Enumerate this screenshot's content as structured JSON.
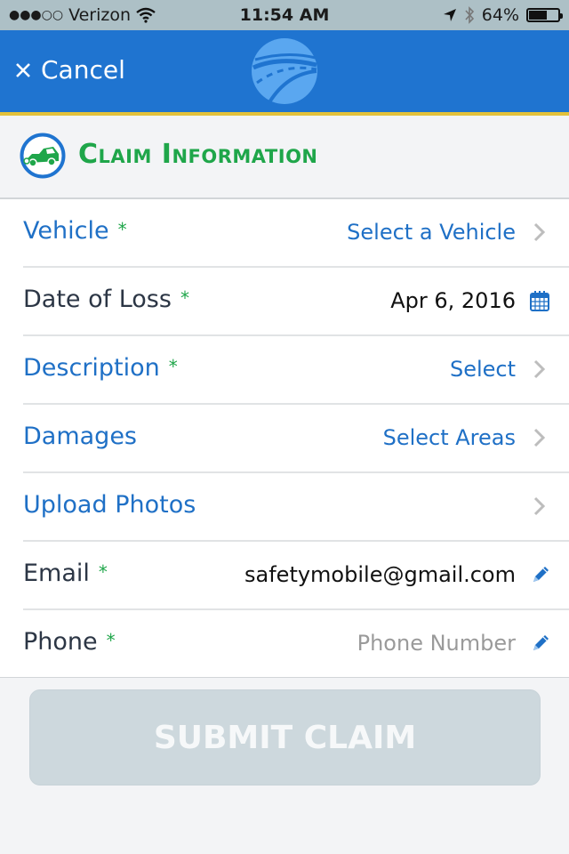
{
  "status_bar": {
    "signal_dots": "●●●○○",
    "carrier": "Verizon",
    "time": "11:54 AM",
    "battery_percent_label": "64%",
    "battery_level": 0.64
  },
  "nav": {
    "cancel_label": "Cancel",
    "logo": "road-logo-icon"
  },
  "section": {
    "title": "Claim Information",
    "icon": "tow-truck-icon"
  },
  "rows": [
    {
      "label": "Vehicle",
      "required": "*",
      "value": "Select a Vehicle",
      "trail_icon": "chevron-right-icon"
    },
    {
      "label": "Date of Loss",
      "required": "*",
      "value": "Apr 6, 2016",
      "trail_icon": "calendar-icon"
    },
    {
      "label": "Description",
      "required": "*",
      "value": "Select",
      "trail_icon": "chevron-right-icon"
    },
    {
      "label": "Damages",
      "required": "",
      "value": "Select Areas",
      "trail_icon": "chevron-right-icon"
    },
    {
      "label": "Upload Photos",
      "required": "",
      "value": "",
      "trail_icon": "chevron-right-icon"
    },
    {
      "label": "Email",
      "required": "*",
      "value": "safetymobile@gmail.com",
      "trail_icon": "pencil-icon"
    },
    {
      "label": "Phone",
      "required": "*",
      "value": "",
      "placeholder": "Phone Number",
      "trail_icon": "pencil-icon"
    }
  ],
  "submit_label": "SUBMIT CLAIM",
  "colors": {
    "nav_blue": "#1f74d0",
    "accent_yellow": "#e3c13a",
    "link_blue": "#1f70c6",
    "green": "#1fa64a",
    "disabled_button": "#cdd8dd"
  }
}
